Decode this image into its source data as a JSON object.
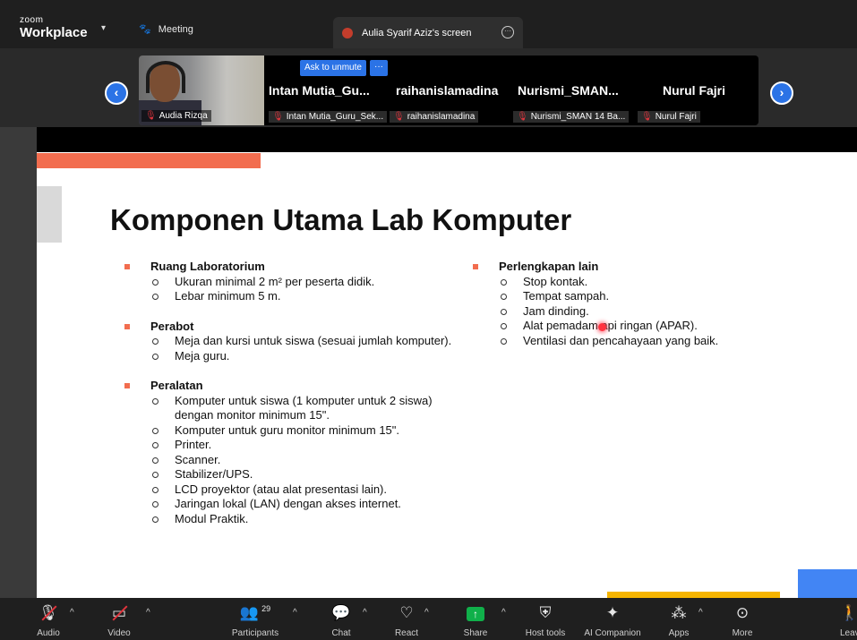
{
  "app": {
    "brand_small": "zoom",
    "brand_big": "Workplace",
    "meeting_label": "Meeting",
    "share_tab_title": "Aulia Syarif Aziz's screen"
  },
  "gallery": {
    "self_name": "Audia Rizqa",
    "ask_unmute": "Ask to unmute",
    "more": "···",
    "tiles": [
      {
        "name": "Intan Mutia_Gu...",
        "label": "Intan Mutia_Guru_Sek..."
      },
      {
        "name": "raihanislamadina",
        "label": "raihanislamadina"
      },
      {
        "name": "Nurismi_SMAN...",
        "label": "Nurismi_SMAN 14 Ba..."
      },
      {
        "name": "Nurul Fajri",
        "label": "Nurul Fajri"
      }
    ]
  },
  "slide": {
    "title": "Komponen Utama Lab Komputer",
    "left": [
      {
        "title": "Ruang Laboratorium",
        "items": [
          "Ukuran minimal 2 m² per peserta didik.",
          "Lebar minimum 5 m."
        ]
      },
      {
        "title": "Perabot",
        "items": [
          "Meja dan kursi untuk siswa (sesuai jumlah komputer).",
          "Meja guru."
        ]
      },
      {
        "title": "Peralatan",
        "items": [
          "Komputer untuk siswa (1 komputer untuk 2 siswa) dengan monitor minimum 15\".",
          "Komputer untuk guru monitor minimum 15\".",
          "Printer.",
          "Scanner.",
          "Stabilizer/UPS.",
          "LCD proyektor (atau alat presentasi lain).",
          "Jaringan lokal (LAN) dengan akses internet.",
          "Modul Praktik."
        ]
      }
    ],
    "right": [
      {
        "title": "Perlengkapan lain",
        "items": [
          "Stop kontak.",
          "Tempat sampah.",
          "Jam dinding.",
          "Alat pemadam api ringan (APAR).",
          "Ventilasi dan pencahayaan yang baik."
        ]
      }
    ]
  },
  "toolbar": {
    "audio": "Audio",
    "video": "Video",
    "participants": "Participants",
    "participants_count": "29",
    "chat": "Chat",
    "react": "React",
    "share": "Share",
    "host_tools": "Host tools",
    "ai_companion": "AI Companion",
    "apps": "Apps",
    "more": "More",
    "leave": "Leave"
  },
  "colors": {
    "accent": "#2b73e6",
    "slide_orange": "#f26d4f",
    "share_green": "#10b04a",
    "mic_off": "#e0353d"
  }
}
